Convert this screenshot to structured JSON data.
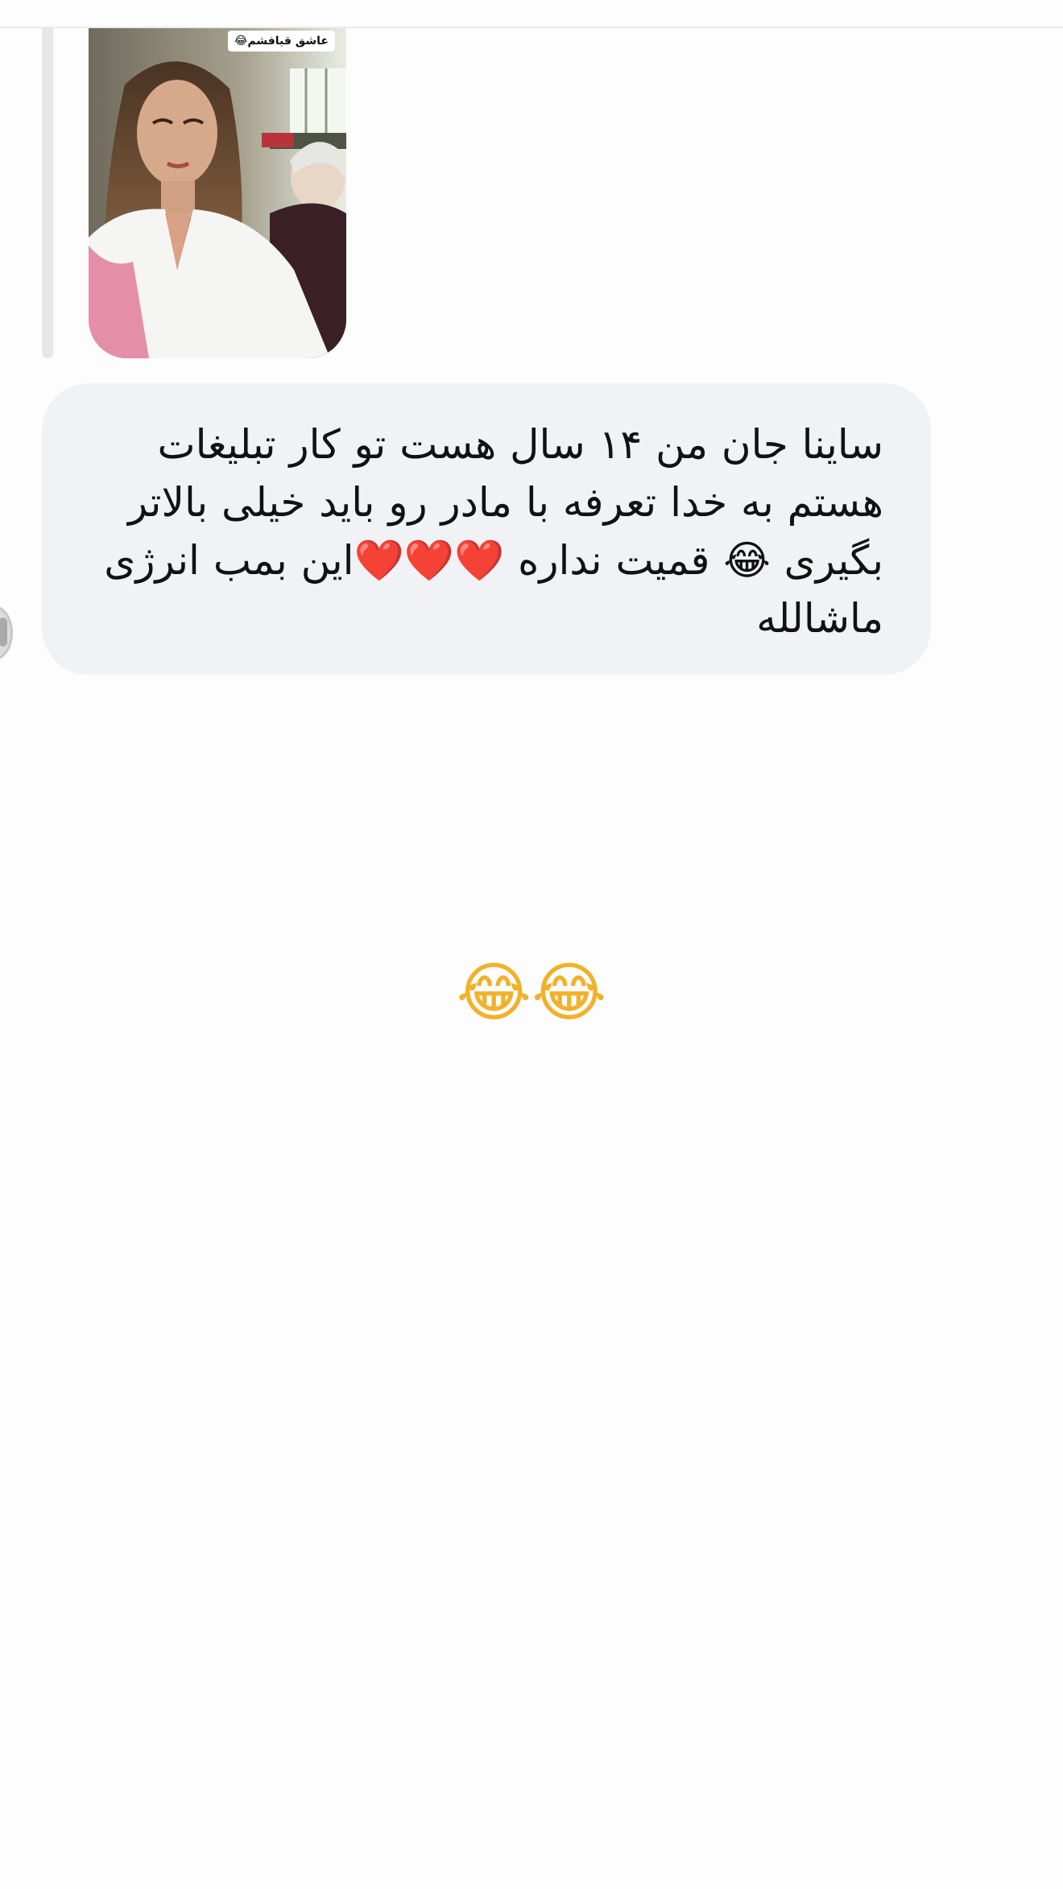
{
  "shared_post": {
    "caption": "عاشق قیافشم😂"
  },
  "message": {
    "text": "ساینا جان من ۱۴ سال هست تو کار تبلیغات هستم به خدا تعرفه با مادر رو باید خیلی بالاتر بگیری 😂 قمیت نداره ❤️❤️❤️این بمب انرژی ماشالله"
  },
  "reaction_message": {
    "text": "😂😂"
  },
  "colors": {
    "bubble_background": "#f0f2f5",
    "page_background": "#fdfdfd",
    "text": "#111111"
  }
}
